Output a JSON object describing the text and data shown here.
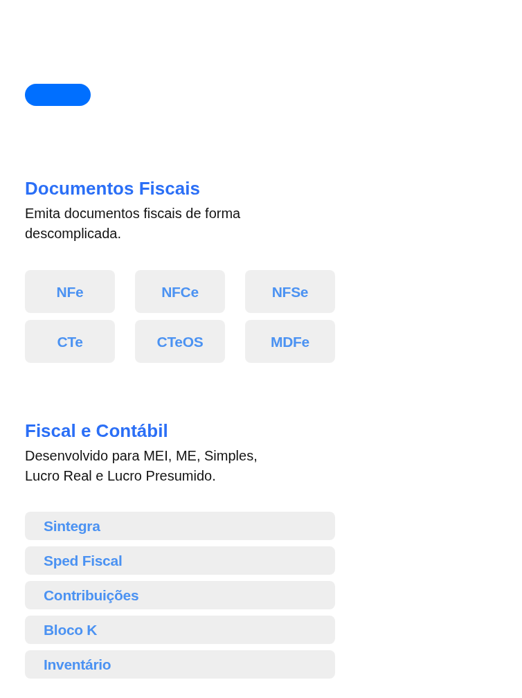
{
  "sections": [
    {
      "kind": "grid",
      "title": "Documentos Fiscais",
      "description": "Emita documentos fiscais de forma descomplicada.",
      "items": [
        "NFe",
        "NFCe",
        "NFSe",
        "CTe",
        "CTeOS",
        "MDFe"
      ]
    },
    {
      "kind": "list",
      "title": "Fiscal e Contábil",
      "description": "Desenvolvido para MEI, ME, Simples, Lucro Real e Lucro Presumido.",
      "items": [
        "Sintegra",
        "Sped Fiscal",
        "Contribuições",
        "Bloco K",
        "Inventário"
      ]
    }
  ]
}
